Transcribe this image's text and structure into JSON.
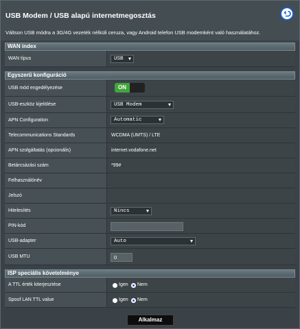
{
  "header": {
    "title": "USB Modem / USB alapú internetmegosztás",
    "description": "Váltson USB módra a 3G/4G vezeték nélküli ceruza, vagy Android telefon USB modemként való használatához.",
    "back_icon": "back-arrow-icon"
  },
  "wan_index": {
    "section_title": "WAN index",
    "wan_type_label": "WAN típus",
    "wan_type_value": "USB"
  },
  "easy_config": {
    "section_title": "Egyszerű konfiguráció",
    "usb_mode_label": "USB mód engedélyezése",
    "usb_mode_toggle": "ON",
    "device_select_label": "USB-eszköz kijelölése",
    "device_select_value": "USB Modem",
    "apn_config_label": "APN Configuration",
    "apn_config_value": "Automatic",
    "telecom_label": "Telecommunications Standards",
    "telecom_value": "WCDMA (UMTS) / LTE",
    "apn_service_label": "APN szolgáltatás (opcionális)",
    "apn_service_value": "internet.vodafone.net",
    "dial_label": "Betárcsázási szám",
    "dial_value": "*99#",
    "username_label": "Felhasználónév",
    "password_label": "Jelszó",
    "auth_label": "Hitelesítés",
    "auth_value": "Nincs",
    "pin_label": "PIN-kód",
    "pin_value": "",
    "adapter_label": "USB-adapter",
    "adapter_value": "Auto",
    "mtu_label": "USB MTU",
    "mtu_value": "0"
  },
  "isp": {
    "section_title": "ISP speciális követelménye",
    "ttl_label": "A TTL érték kiterjesztése",
    "spoof_label": "Spoof LAN TTL value",
    "yes_label": "Igen",
    "no_label": "Nem",
    "ttl_selected": "Nem",
    "spoof_selected": "Nem"
  },
  "apply_label": "Alkalmaz",
  "colors": {
    "toggle_on": "#41a53b",
    "radio_selected": "#1f57d8",
    "back_border": "#1c5cc4"
  }
}
